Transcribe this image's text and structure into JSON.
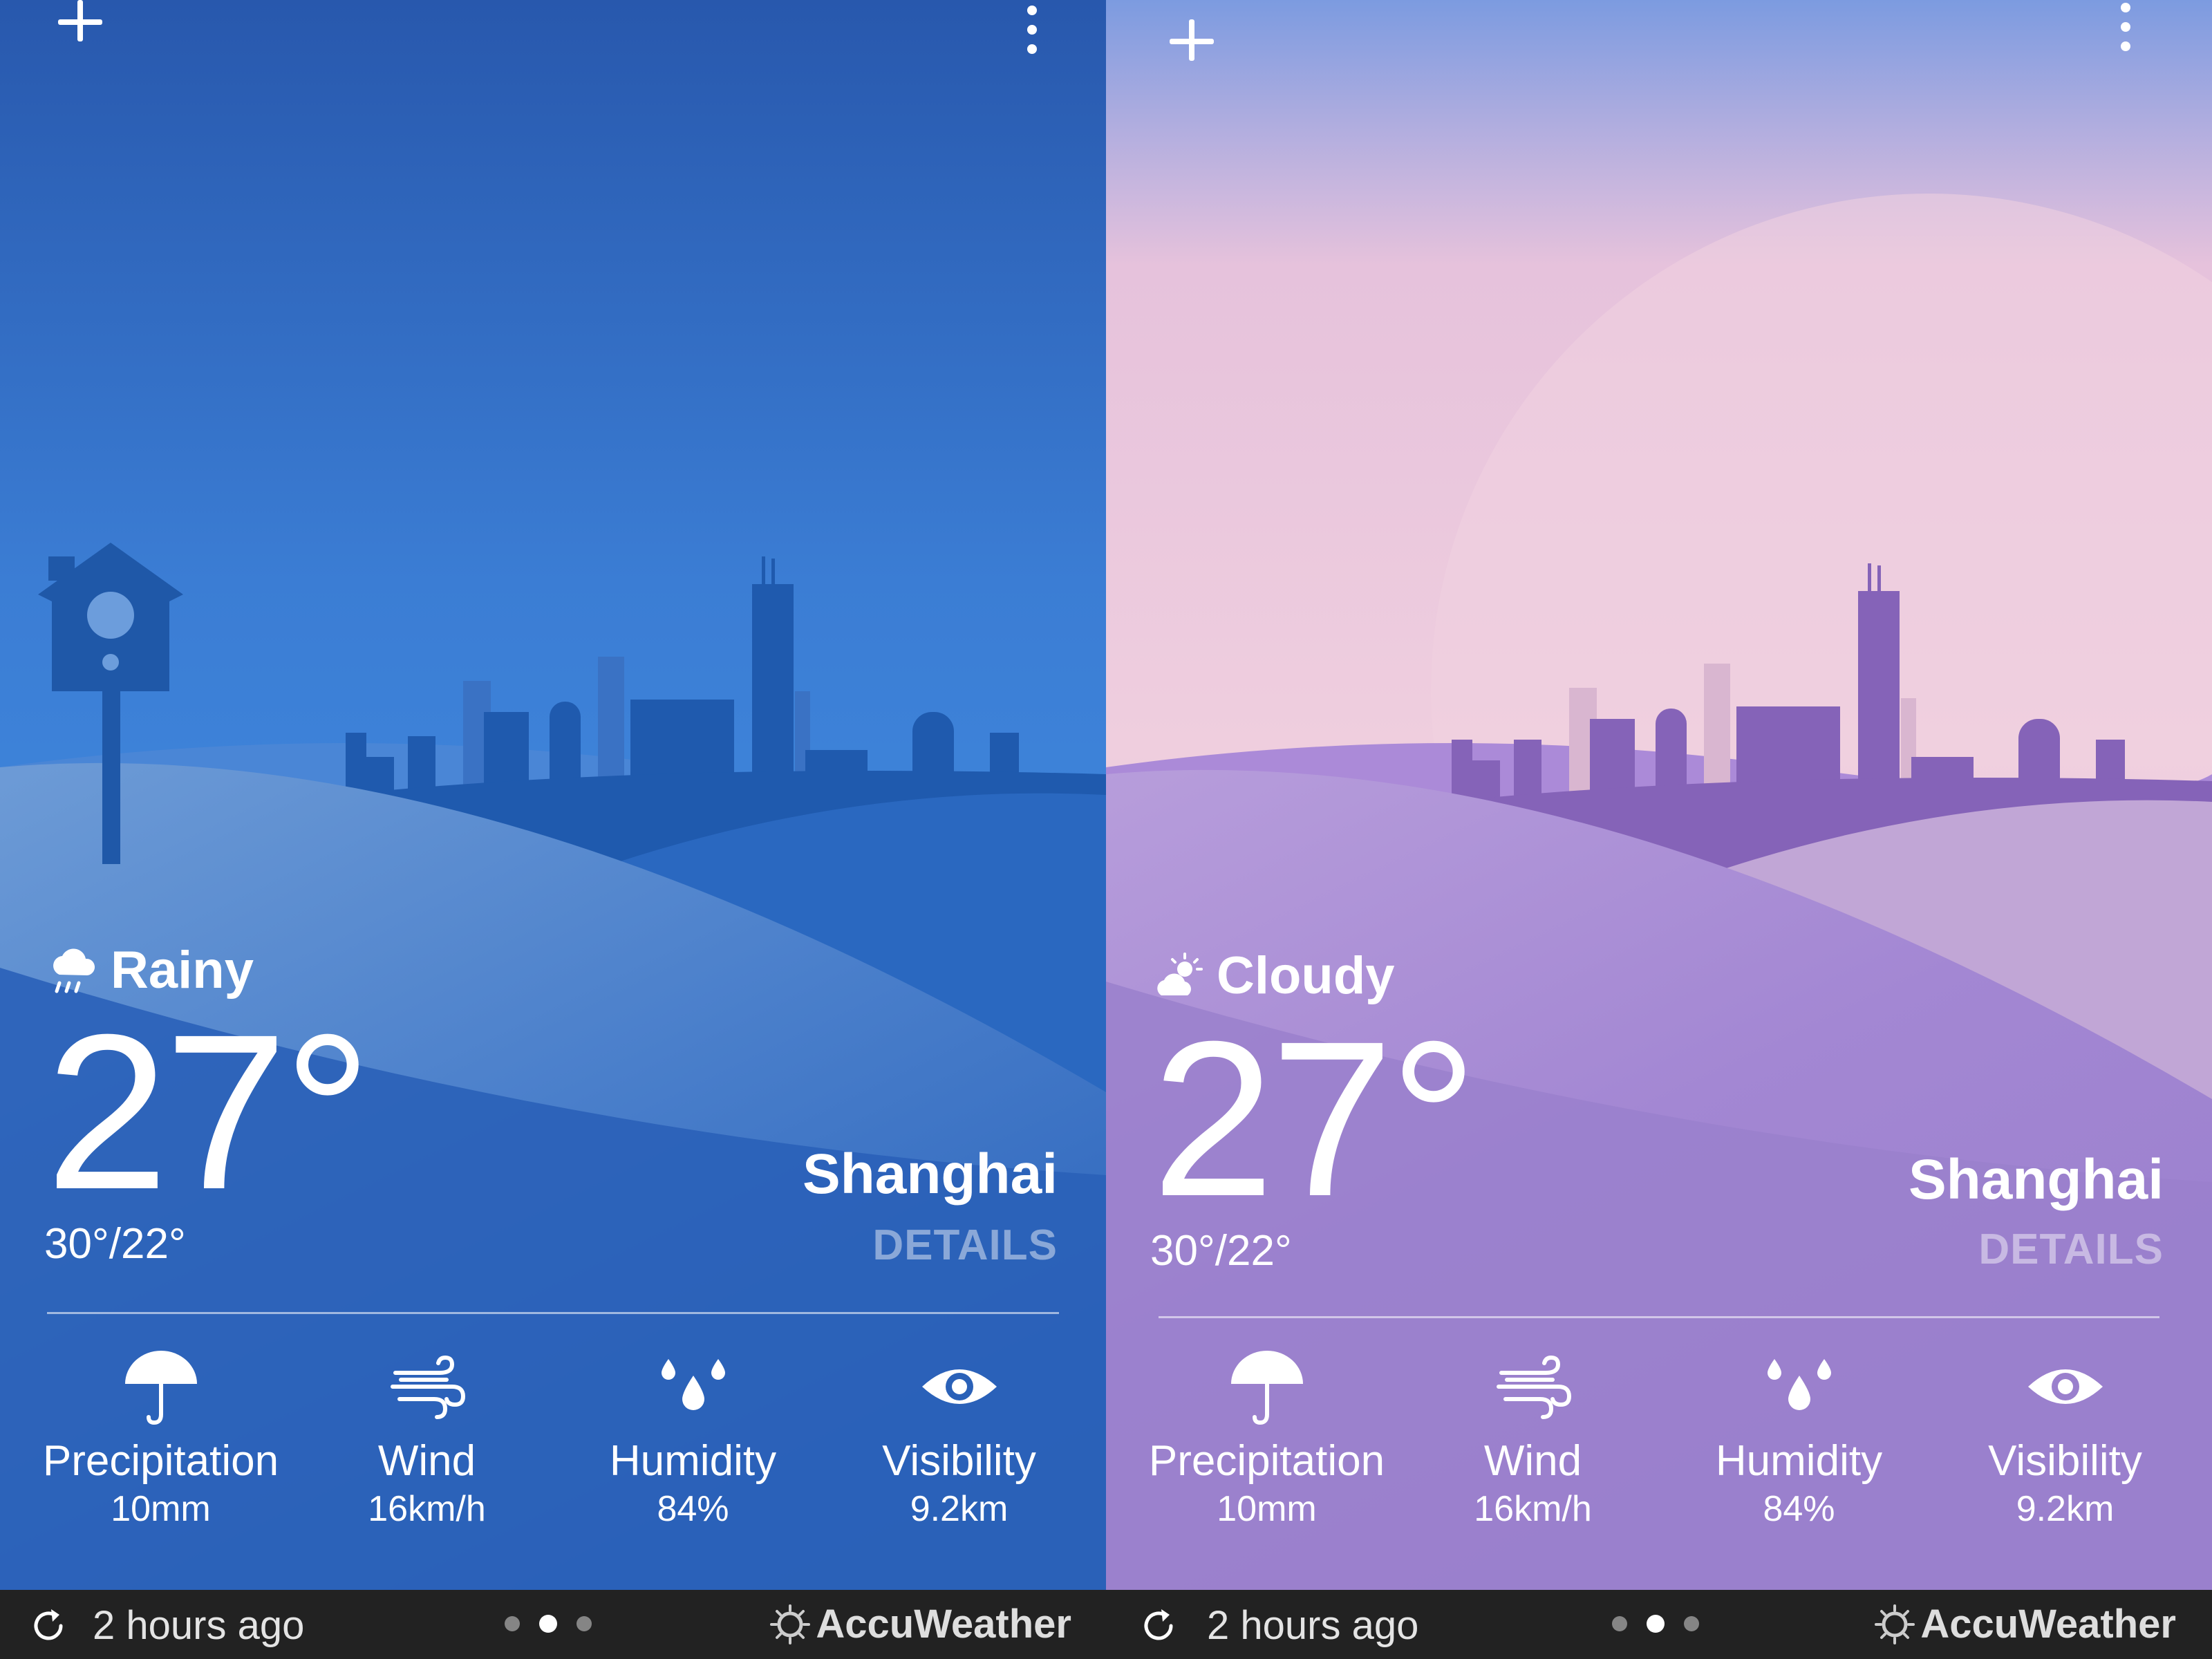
{
  "screens": [
    {
      "theme": "rainy",
      "colors": {
        "sky_top": "#2a5fb3",
        "sky_mid": "#3f83d8",
        "hills": "#2c66bd",
        "city": "#1d56a8",
        "accent": "#6f99d0"
      },
      "condition": {
        "icon": "rain-cloud-icon",
        "label": "Rainy"
      },
      "temperature": "27°",
      "hilo": "30°/22°",
      "city": "Shanghai",
      "details": "DETAILS",
      "metrics": [
        {
          "icon": "umbrella-icon",
          "label": "Precipitation",
          "value": "10mm"
        },
        {
          "icon": "wind-icon",
          "label": "Wind",
          "value": "16km/h"
        },
        {
          "icon": "humidity-drops-icon",
          "label": "Humidity",
          "value": "84%"
        },
        {
          "icon": "eye-icon",
          "label": "Visibility",
          "value": "9.2km"
        }
      ],
      "footer": {
        "updated": "2 hours ago",
        "brand": "AccuWeather",
        "pages": 3,
        "active_page": 2
      }
    },
    {
      "theme": "cloudy",
      "colors": {
        "sky_top": "#7e9ce0",
        "sky_mid": "#ecc9dc",
        "hills": "#9a80cc",
        "city": "#8563b8",
        "accent": "#c9a9e0"
      },
      "condition": {
        "icon": "sun-cloud-icon",
        "label": "Cloudy"
      },
      "temperature": "27°",
      "hilo": "30°/22°",
      "city": "Shanghai",
      "details": "DETAILS",
      "metrics": [
        {
          "icon": "umbrella-icon",
          "label": "Precipitation",
          "value": "10mm"
        },
        {
          "icon": "wind-icon",
          "label": "Wind",
          "value": "16km/h"
        },
        {
          "icon": "humidity-drops-icon",
          "label": "Humidity",
          "value": "84%"
        },
        {
          "icon": "eye-icon",
          "label": "Visibility",
          "value": "9.2km"
        }
      ],
      "footer": {
        "updated": "2 hours ago",
        "brand": "AccuWeather",
        "pages": 3,
        "active_page": 2
      }
    }
  ]
}
